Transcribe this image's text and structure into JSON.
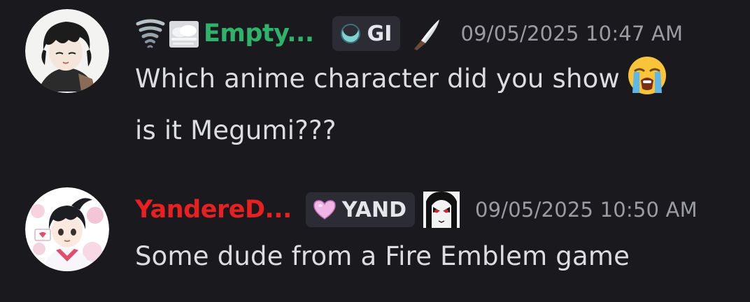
{
  "messages": [
    {
      "username": "Empty...",
      "tag": "GI",
      "timestamp": "09/05/2025 10:47 AM",
      "lines": [
        "Which anime character did you show",
        "is it Megumi???"
      ],
      "emoji": "loudly-crying-face",
      "name_color": "#2fb36b"
    },
    {
      "username": "YandereD...",
      "tag": "YAND",
      "timestamp": "09/05/2025 10:50 AM",
      "lines": [
        "Some dude from a Fire Emblem game"
      ],
      "name_color": "#e8201f"
    }
  ],
  "colors": {
    "background": "#1a1a1e",
    "tag_background": "#2c2d34",
    "timestamp": "#9a9ca2",
    "text": "#dcdde1"
  }
}
